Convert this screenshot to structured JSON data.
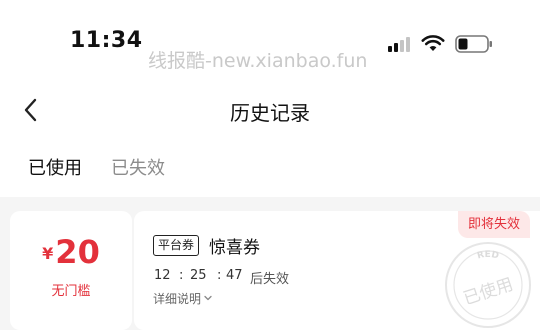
{
  "status_bar": {
    "time": "11:34",
    "watermark": "线报酷-new.xianbao.fun"
  },
  "nav": {
    "title": "历史记录"
  },
  "tabs": [
    {
      "label": "已使用",
      "active": true
    },
    {
      "label": "已失效",
      "active": false
    }
  ],
  "coupon": {
    "currency": "¥",
    "amount": "20",
    "threshold": "无门槛",
    "type_badge": "平台券",
    "name": "惊喜券",
    "countdown": {
      "hours": "12",
      "minutes": "25",
      "seconds": "47",
      "separator": ":",
      "suffix": "后失效"
    },
    "details_label": "详细说明",
    "expiring_tag": "即将失效",
    "stamp": {
      "top_text": "RED",
      "main_text": "已使用"
    }
  },
  "colors": {
    "accent": "#e3313b",
    "tag_bg": "#fde8e8",
    "list_bg": "#f5f5f5",
    "stamp": "#e6e6e6"
  }
}
